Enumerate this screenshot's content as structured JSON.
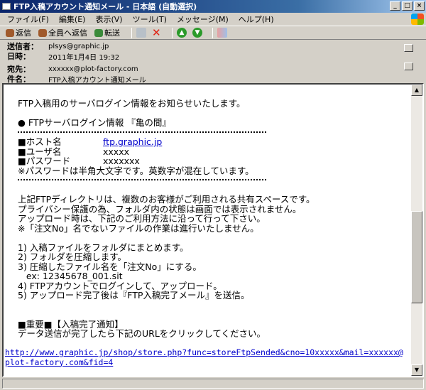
{
  "window": {
    "title": "FTP入稿アカウント通知メール - 日本語 (自動選択)",
    "minimize": "_",
    "maximize": "□",
    "close": "×"
  },
  "menu": [
    "ファイル(F)",
    "編集(E)",
    "表示(V)",
    "ツール(T)",
    "メッセージ(M)",
    "ヘルプ(H)"
  ],
  "toolbar": {
    "reply": "返信",
    "reply_all": "全員へ返信",
    "forward": "転送"
  },
  "header": {
    "from_label": "送信者：",
    "from": "plsys@graphic.jp",
    "date_label": "日時：",
    "date": "2011年1月4日 19:32",
    "to_label": "宛先：",
    "to": "xxxxxx@plot-factory.com",
    "subject_label": "件名：",
    "subject": "FTP入稿アカウント通知メール"
  },
  "body": {
    "intro": "FTP入稿用のサーバログイン情報をお知らせいたします。",
    "section": "● FTPサーバログイン情報 『亀の間』",
    "host_label": "■ホスト名",
    "host": "ftp.graphic.jp",
    "user_label": "■ユーザ名",
    "user": "xxxxx",
    "pw_label": "■パスワード",
    "pw": "xxxxxxx",
    "pw_note": "※パスワードは半角大文字です。英数字が混在しています。",
    "para": [
      "上記FTPディレクトリは、複数のお客様がご利用される共有スペースです。",
      "プライバシー保護の為、フォルダ内の状態は画面では表示されません。",
      "アップロード時は、下記のご利用方法に沿って行って下さい。",
      "※「注文No」名でないファイルの作業は進行いたしません。"
    ],
    "steps": [
      "1) 入稿ファイルをフォルダにまとめます。",
      "2) フォルダを圧縮します。",
      "3) 圧縮したファイル名を「注文No」にする。",
      "   ex: 12345678_001.sit",
      "4) FTPアカウントでログインして、アップロード。",
      "5) アップロード完了後は『FTP入稿完了メール』を送信。"
    ],
    "important": "■重要■【入稿完了通知】",
    "important_text": "データ送信が完了したら下記のURLをクリックしてください。",
    "url": "http://www.graphic.jp/shop/store.php?func=storeFtpSended&cno=10xxxxx&mail=xxxxxx@plot-factory.com&fid=4"
  }
}
